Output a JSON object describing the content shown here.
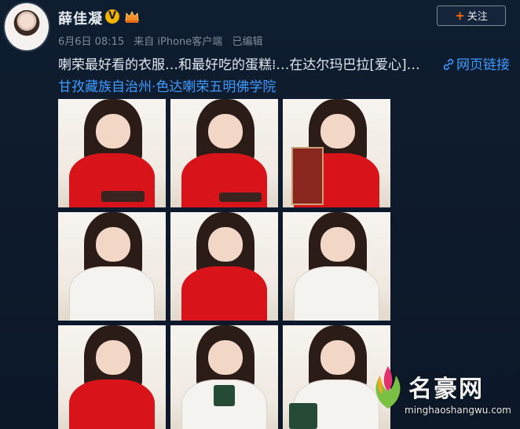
{
  "post": {
    "username": "薛佳凝",
    "verify_glyph": "V",
    "follow_label": "关注",
    "date": "6月6日 08:15",
    "source": "来自 iPhone客户端",
    "edited": "已编辑",
    "text_line1": "喇荣最好看的衣服…和最好吃的蛋糕⁞…在达尔玛巴拉[爱心]…",
    "weblink": "网页链接",
    "location": "甘孜藏族自治州·色达喇荣五明佛学院"
  },
  "photos": [
    {
      "shirt": "red"
    },
    {
      "shirt": "red"
    },
    {
      "shirt": "red"
    },
    {
      "shirt": "white"
    },
    {
      "shirt": "red"
    },
    {
      "shirt": "white"
    },
    {
      "shirt": "red"
    },
    {
      "shirt": "white"
    },
    {
      "shirt": "white"
    }
  ],
  "watermark": {
    "name": "名豪网",
    "url": "minghaoshangwu.com"
  },
  "colors": {
    "background": "#0d1a2b",
    "link": "#3d9bff",
    "follow_plus": "#ff6a00",
    "verify": "#f2b200"
  }
}
